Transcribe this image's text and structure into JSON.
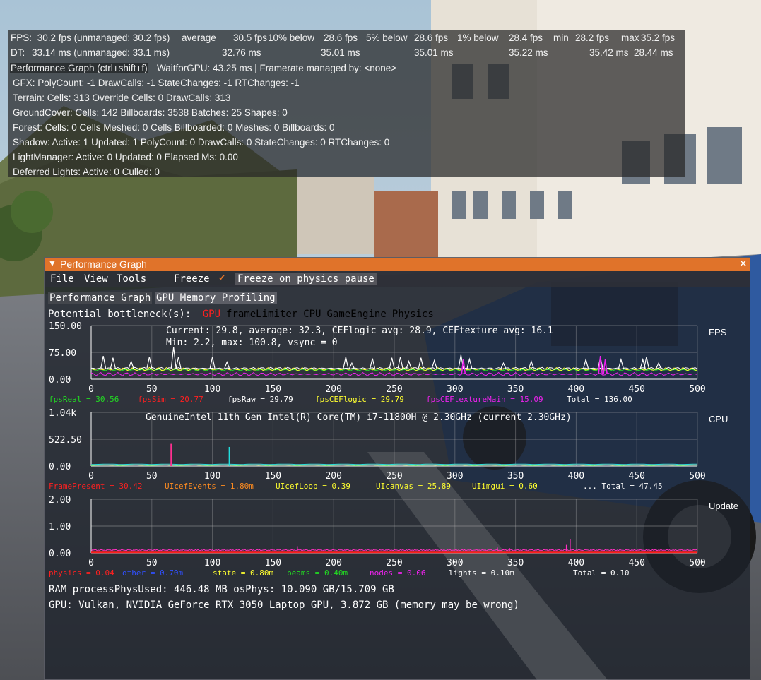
{
  "stats": {
    "fps_line": {
      "label": "FPS:",
      "value": "30.2 fps (unmanaged:  30.2 fps)",
      "average_label": "average",
      "average": "30.5 fps",
      "below10_label": "10% below",
      "below10": "28.6 fps",
      "below5_label": "5% below",
      "below5": "28.6 fps",
      "below1_label": "1% below",
      "below1": "28.4 fps",
      "min_label": "min",
      "min": "28.2 fps",
      "max_label": "max",
      "max": "35.2 fps"
    },
    "dt_line": {
      "label": "DT:",
      "value": "33.14 ms (unmanaged:  33.1 ms)",
      "average": "32.76 ms",
      "below10": "35.01 ms",
      "below5": "35.01 ms",
      "below1": "35.22 ms",
      "min": "35.42 ms",
      "max": "28.44 ms"
    },
    "header": "Performance Graph (ctrl+shift+f)",
    "header_info": "WaitforGPU: 43.25 ms | Framerate managed by: <none>",
    "lines": [
      "GFX:  PolyCount: -1 DrawCalls: -1  StateChanges: -1  RTChanges: -1",
      "Terrain:  Cells: 313  Override Cells: 0  DrawCalls: 313",
      "GroundCover:  Cells: 142  Billboards: 3538  Batches: 25  Shapes: 0",
      "Forest:  Cells: 0  Cells Meshed: 0  Cells Billboarded: 0  Meshes: 0  Billboards: 0",
      "Shadow:  Active: 1  Updated: 1  PolyCount: 0  DrawCalls: 0  StateChanges: 0  RTChanges: 0",
      "LightManager:  Active: 0  Updated: 0  Elapsed Ms:  0.00",
      "Deferred Lights:  Active: 0  Culled: 0"
    ]
  },
  "window": {
    "title": "Performance Graph",
    "menu": {
      "file": "File",
      "view": "View",
      "tools": "Tools",
      "freeze": "Freeze",
      "freeze_physics": "Freeze on physics pause"
    },
    "tabs": [
      "Performance Graph",
      "GPU Memory Profiling"
    ],
    "bottleneck_label": "Potential bottleneck(s):",
    "bottlenecks": [
      {
        "name": "GPU",
        "color": "#ff2020"
      },
      {
        "name": "frameLimiter",
        "color": "#000000"
      },
      {
        "name": "CPU",
        "color": "#000000"
      },
      {
        "name": "GameEngine",
        "color": "#000000"
      },
      {
        "name": "Physics",
        "color": "#000000"
      }
    ],
    "ram_line": "RAM  processPhysUsed: 446.48 MB  osPhys: 10.090 GB/15.709 GB",
    "gpu_line": "GPU: Vulkan, NVIDIA GeForce RTX 3050 Laptop GPU, 3.872 GB (memory may be wrong)"
  },
  "chart_data": [
    {
      "type": "line",
      "name": "FPS",
      "ylim": [
        0,
        150
      ],
      "xlim": [
        0,
        500
      ],
      "y_ticks": [
        "150.00",
        "75.00",
        "0.00"
      ],
      "x_ticks": [
        "0",
        "50",
        "100",
        "150",
        "200",
        "250",
        "300",
        "350",
        "400",
        "450",
        "500"
      ],
      "annotation_line1": "Current: 29.8, average: 32.3, CEFlogic avg: 28.9, CEFtexture avg: 16.1",
      "annotation_line2": "Min:  2.2, max: 100.8, vsync = 0",
      "legend": [
        {
          "label": "fpsReal =",
          "value": "30.56",
          "color": "#22dd22"
        },
        {
          "label": "fpsSim =",
          "value": "20.77",
          "color": "#ff2020"
        },
        {
          "label": "fpsRaw =",
          "value": "29.79",
          "color": "#ffffff"
        },
        {
          "label": "fpsCEFlogic =",
          "value": "29.79",
          "color": "#ffff30"
        },
        {
          "label": "fpsCEFtextureMain =",
          "value": "15.09",
          "color": "#ee22ee"
        }
      ],
      "total": "Total = 136.00",
      "series_colors": [
        "#ffffff",
        "#ffff30",
        "#ee22ee",
        "#22dd22"
      ],
      "base_values": {
        "white": 30,
        "yellow": 28,
        "magenta": 14,
        "green": 26
      },
      "spikes": [
        {
          "x": 10,
          "y": 65
        },
        {
          "x": 18,
          "y": 60
        },
        {
          "x": 33,
          "y": 50
        },
        {
          "x": 48,
          "y": 62
        },
        {
          "x": 68,
          "y": 90
        },
        {
          "x": 72,
          "y": 62
        },
        {
          "x": 100,
          "y": 62
        },
        {
          "x": 112,
          "y": 48
        },
        {
          "x": 210,
          "y": 62
        },
        {
          "x": 215,
          "y": 45
        },
        {
          "x": 232,
          "y": 58
        },
        {
          "x": 248,
          "y": 60
        },
        {
          "x": 255,
          "y": 62
        },
        {
          "x": 262,
          "y": 50
        },
        {
          "x": 272,
          "y": 60
        },
        {
          "x": 283,
          "y": 52
        },
        {
          "x": 305,
          "y": 68
        },
        {
          "x": 312,
          "y": 56
        },
        {
          "x": 340,
          "y": 45
        },
        {
          "x": 363,
          "y": 50
        },
        {
          "x": 408,
          "y": 55
        },
        {
          "x": 420,
          "y": 60
        },
        {
          "x": 437,
          "y": 55
        },
        {
          "x": 455,
          "y": 55
        },
        {
          "x": 458,
          "y": 62
        },
        {
          "x": 468,
          "y": 45
        }
      ],
      "magenta_spikes": [
        {
          "x": 307,
          "y": 55
        },
        {
          "x": 420,
          "y": 65
        },
        {
          "x": 424,
          "y": 55
        }
      ]
    },
    {
      "type": "line",
      "name": "CPU",
      "ylim": [
        0,
        1040
      ],
      "xlim": [
        0,
        500
      ],
      "y_ticks": [
        "1.04k",
        "522.50",
        "0.00"
      ],
      "x_ticks": [
        "0",
        "50",
        "100",
        "150",
        "200",
        "250",
        "300",
        "350",
        "400",
        "450",
        "500"
      ],
      "annotation_line1": "GenuineIntel 11th Gen Intel(R) Core(TM) i7-11800H @ 2.30GHz (current 2.30GHz)",
      "legend": [
        {
          "label": "FramePresent =",
          "value": "30.42",
          "color": "#ff2020"
        },
        {
          "label": "UIcefEvents =",
          "value": "1.80m",
          "color": "#ff8c20"
        },
        {
          "label": "UIcefLoop =",
          "value": "0.39",
          "color": "#ffff30"
        },
        {
          "label": "UIcanvas =",
          "value": "25.89",
          "color": "#ffff30"
        },
        {
          "label": "UIimgui =",
          "value": "0.60",
          "color": "#ffff30"
        }
      ],
      "total": "... Total = 47.45",
      "spikes": [
        {
          "x": 66,
          "y": 430,
          "color": "#ff3090"
        },
        {
          "x": 114,
          "y": 370,
          "color": "#22dddd"
        }
      ]
    },
    {
      "type": "line",
      "name": "Update",
      "ylim": [
        0,
        2
      ],
      "xlim": [
        0,
        500
      ],
      "y_ticks": [
        "2.00",
        "1.00",
        "0.00"
      ],
      "x_ticks": [
        "0",
        "50",
        "100",
        "150",
        "200",
        "250",
        "300",
        "350",
        "400",
        "450",
        "500"
      ],
      "legend": [
        {
          "label": "physics =",
          "value": "0.04",
          "color": "#ff2020"
        },
        {
          "label": "other =",
          "value": "0.70m",
          "color": "#3050ff"
        },
        {
          "label": "state =",
          "value": "0.80m",
          "color": "#ffff30"
        },
        {
          "label": "beams =",
          "value": "0.40m",
          "color": "#22dd22"
        },
        {
          "label": "nodes =",
          "value": "0.06",
          "color": "#ee22ee"
        },
        {
          "label": "lights =",
          "value": "0.10m",
          "color": "#ffffff"
        }
      ],
      "total": "Total = 0.10",
      "spikes": [
        {
          "x": 170,
          "y": 0.25
        },
        {
          "x": 210,
          "y": 0.12
        },
        {
          "x": 335,
          "y": 0.2
        },
        {
          "x": 345,
          "y": 0.18
        },
        {
          "x": 392,
          "y": 0.3
        },
        {
          "x": 395,
          "y": 0.5
        },
        {
          "x": 466,
          "y": 0.15
        }
      ]
    }
  ]
}
